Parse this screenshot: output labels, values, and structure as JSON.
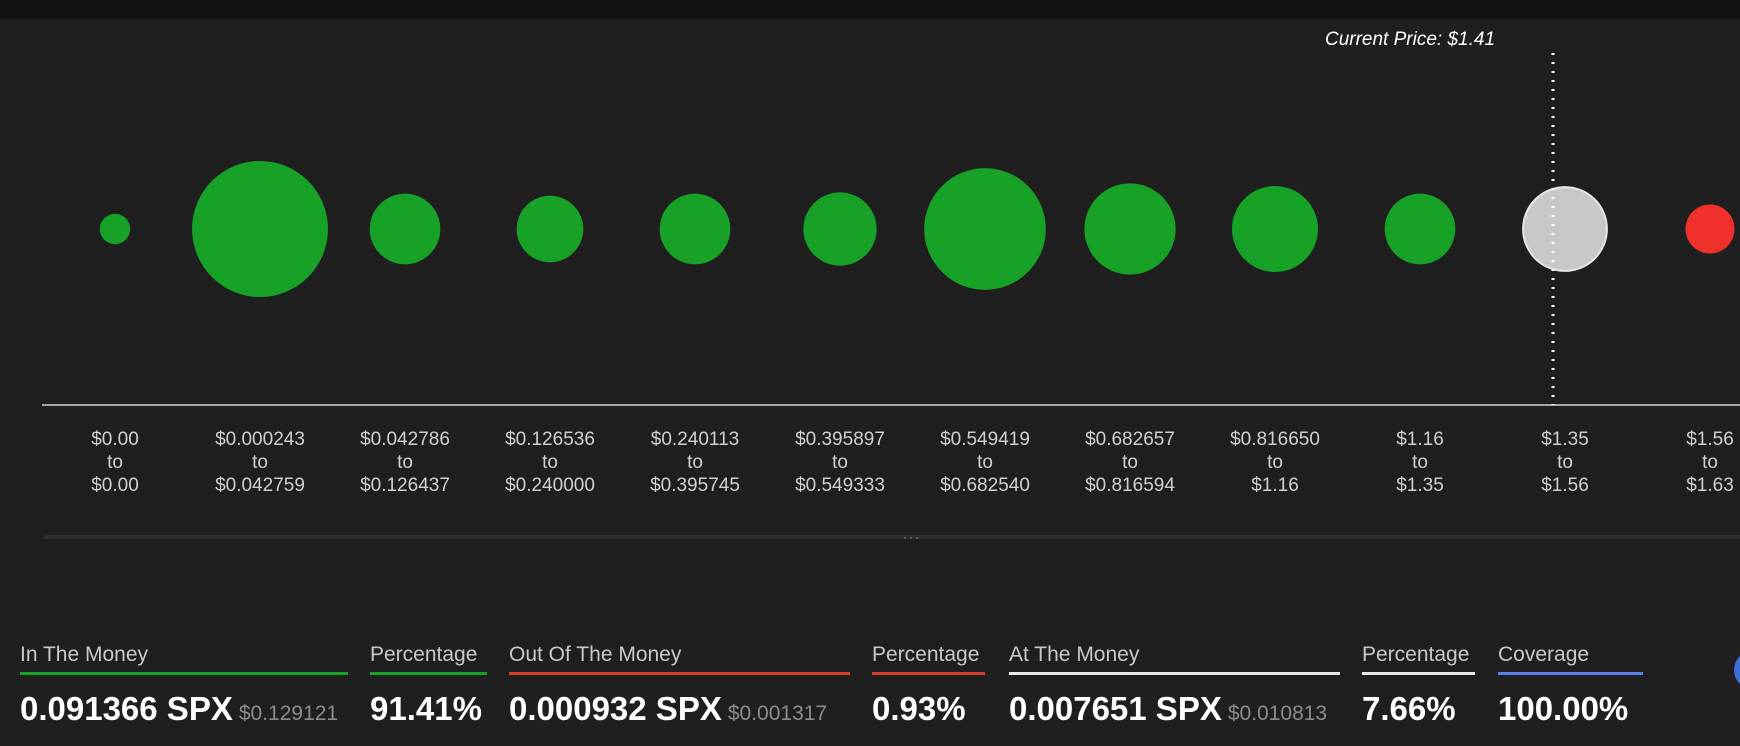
{
  "chart_data": {
    "type": "bubble",
    "current_price_label": "Current Price: $1.41",
    "current_price": 1.41,
    "buckets": [
      {
        "from": "$0.00",
        "to_word": "to",
        "to": "$0.00",
        "size": 0.05,
        "status": "in"
      },
      {
        "from": "$0.000243",
        "to_word": "to",
        "to": "$0.042759",
        "size": 1.0,
        "status": "in"
      },
      {
        "from": "$0.042786",
        "to_word": "to",
        "to": "$0.126437",
        "size": 0.27,
        "status": "in"
      },
      {
        "from": "$0.126536",
        "to_word": "to",
        "to": "$0.240000",
        "size": 0.24,
        "status": "in"
      },
      {
        "from": "$0.240113",
        "to_word": "to",
        "to": "$0.395745",
        "size": 0.27,
        "status": "in"
      },
      {
        "from": "$0.395897",
        "to_word": "to",
        "to": "$0.549333",
        "size": 0.29,
        "status": "in"
      },
      {
        "from": "$0.549419",
        "to_word": "to",
        "to": "$0.682540",
        "size": 0.8,
        "status": "in"
      },
      {
        "from": "$0.682657",
        "to_word": "to",
        "to": "$0.816594",
        "size": 0.45,
        "status": "in"
      },
      {
        "from": "$0.816650",
        "to_word": "to",
        "to": "$1.16",
        "size": 0.4,
        "status": "in"
      },
      {
        "from": "$1.16",
        "to_word": "to",
        "to": "$1.35",
        "size": 0.27,
        "status": "in"
      },
      {
        "from": "$1.35",
        "to_word": "to",
        "to": "$1.56",
        "size": 0.38,
        "status": "at"
      },
      {
        "from": "$1.56",
        "to_word": "to",
        "to": "$1.63",
        "size": 0.13,
        "status": "out"
      }
    ],
    "colors": {
      "in": "#17a127",
      "at": "#c8c8c8",
      "out": "#f0302a"
    }
  },
  "stats": {
    "in_the_money": {
      "label": "In The Money",
      "value": "0.091366 SPX",
      "usd": "$0.129121",
      "color": "#17a127"
    },
    "in_percentage": {
      "label": "Percentage",
      "value": "91.41%",
      "color": "#17a127"
    },
    "out_of_the_money": {
      "label": "Out Of The Money",
      "value": "0.000932 SPX",
      "usd": "$0.001317",
      "color": "#d8412f"
    },
    "out_percentage": {
      "label": "Percentage",
      "value": "0.93%",
      "color": "#d8412f"
    },
    "at_the_money": {
      "label": "At The Money",
      "value": "0.007651 SPX",
      "usd": "$0.010813",
      "color": "#e8e8e8"
    },
    "at_percentage": {
      "label": "Percentage",
      "value": "7.66%",
      "color": "#e8e8e8"
    },
    "coverage": {
      "label": "Coverage",
      "value": "100.00%",
      "color": "#5a7fe8"
    }
  }
}
